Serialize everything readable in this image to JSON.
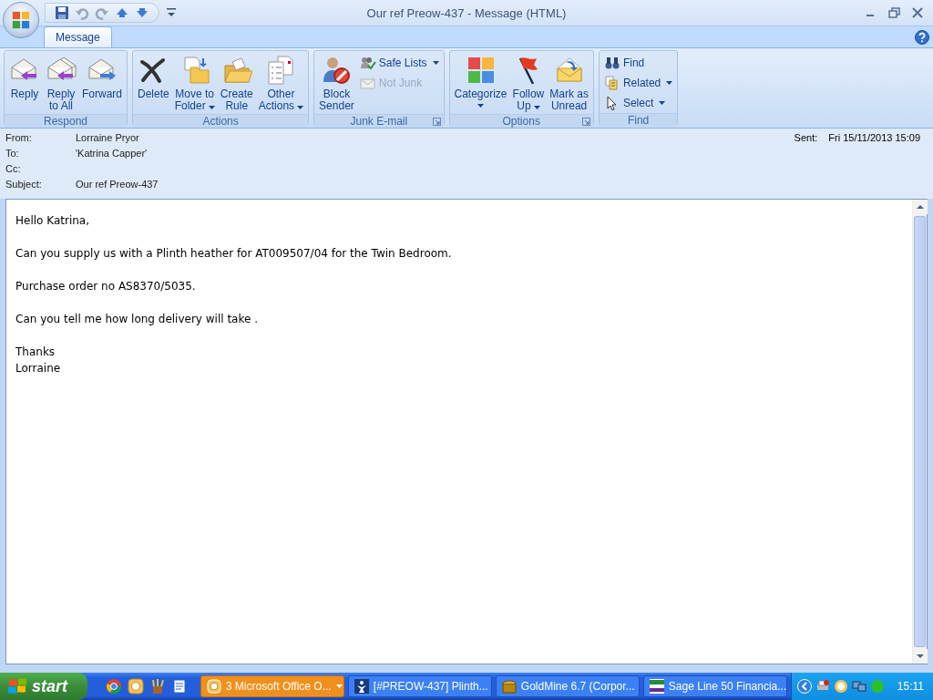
{
  "window": {
    "title": "Our ref Preow-437 - Message (HTML)"
  },
  "tabs": [
    {
      "label": "Message",
      "selected": true
    }
  ],
  "ribbon_groups": [
    {
      "label": "Respond",
      "launcher": false,
      "items": [
        {
          "kind": "large",
          "lines": [
            "Reply"
          ],
          "dropdown": false,
          "disabled": false
        },
        {
          "kind": "large",
          "lines": [
            "Reply",
            "to All"
          ],
          "dropdown": false,
          "disabled": false
        },
        {
          "kind": "large",
          "lines": [
            "Forward"
          ],
          "dropdown": false,
          "disabled": false
        }
      ]
    },
    {
      "label": "Actions",
      "launcher": false,
      "items": [
        {
          "kind": "large",
          "lines": [
            "Delete"
          ],
          "dropdown": false,
          "disabled": false
        },
        {
          "kind": "large",
          "lines": [
            "Move to",
            "Folder"
          ],
          "dropdown": true,
          "disabled": false
        },
        {
          "kind": "large",
          "lines": [
            "Create",
            "Rule"
          ],
          "dropdown": false,
          "disabled": false
        },
        {
          "kind": "large",
          "lines": [
            "Other",
            "Actions"
          ],
          "dropdown": true,
          "disabled": false
        }
      ]
    },
    {
      "label": "Junk E-mail",
      "launcher": true,
      "items": [
        {
          "kind": "large",
          "lines": [
            "Block",
            "Sender"
          ],
          "dropdown": false,
          "disabled": false
        },
        {
          "kind": "small",
          "lines": [
            "Safe Lists"
          ],
          "dropdown": true,
          "disabled": false
        },
        {
          "kind": "small",
          "lines": [
            "Not Junk"
          ],
          "dropdown": false,
          "disabled": true
        }
      ]
    },
    {
      "label": "Options",
      "launcher": true,
      "items": [
        {
          "kind": "large",
          "lines": [
            "Categorize"
          ],
          "dropdown": true,
          "disabled": false
        },
        {
          "kind": "large",
          "lines": [
            "Follow",
            "Up"
          ],
          "dropdown": true,
          "disabled": false
        },
        {
          "kind": "large",
          "lines": [
            "Mark as",
            "Unread"
          ],
          "dropdown": false,
          "disabled": false
        }
      ]
    },
    {
      "label": "Find",
      "launcher": false,
      "items": [
        {
          "kind": "small",
          "lines": [
            "Find"
          ],
          "dropdown": false,
          "disabled": false
        },
        {
          "kind": "small",
          "lines": [
            "Related"
          ],
          "dropdown": true,
          "disabled": false
        },
        {
          "kind": "small",
          "lines": [
            "Select"
          ],
          "dropdown": true,
          "disabled": false
        }
      ]
    }
  ],
  "header": {
    "fields": [
      {
        "label": "From:",
        "value": "Lorraine Pryor"
      },
      {
        "label": "To:",
        "value": "'Katrina Capper'"
      },
      {
        "label": "Cc:"
      },
      {
        "label": "Subject:",
        "value": "Our ref Preow-437"
      }
    ],
    "sent": {
      "label": "Sent:",
      "value": "Fri 15/11/2013 15:09"
    }
  },
  "body": {
    "paragraphs": [
      [
        "Hello Katrina,"
      ],
      [
        "Can you supply us with a Plinth heather for AT009507/04 for the Twin Bedroom."
      ],
      [
        "Purchase order no AS8370/5035."
      ],
      [
        "Can you tell me how long delivery will take ."
      ],
      [
        "Thanks",
        "Lorraine"
      ]
    ]
  },
  "taskbar": {
    "start": "start",
    "tasks": [
      {
        "label": "3 Microsoft Office O...",
        "selected": true,
        "dropdown": true
      },
      {
        "label": "[#PREOW-437] Plinth...",
        "selected": false,
        "dropdown": false
      },
      {
        "label": "GoldMine 6.7 (Corpor...",
        "selected": false,
        "dropdown": false
      },
      {
        "label": "Sage Line 50 Financia...",
        "selected": false,
        "dropdown": false
      }
    ],
    "clock": "15:11"
  }
}
